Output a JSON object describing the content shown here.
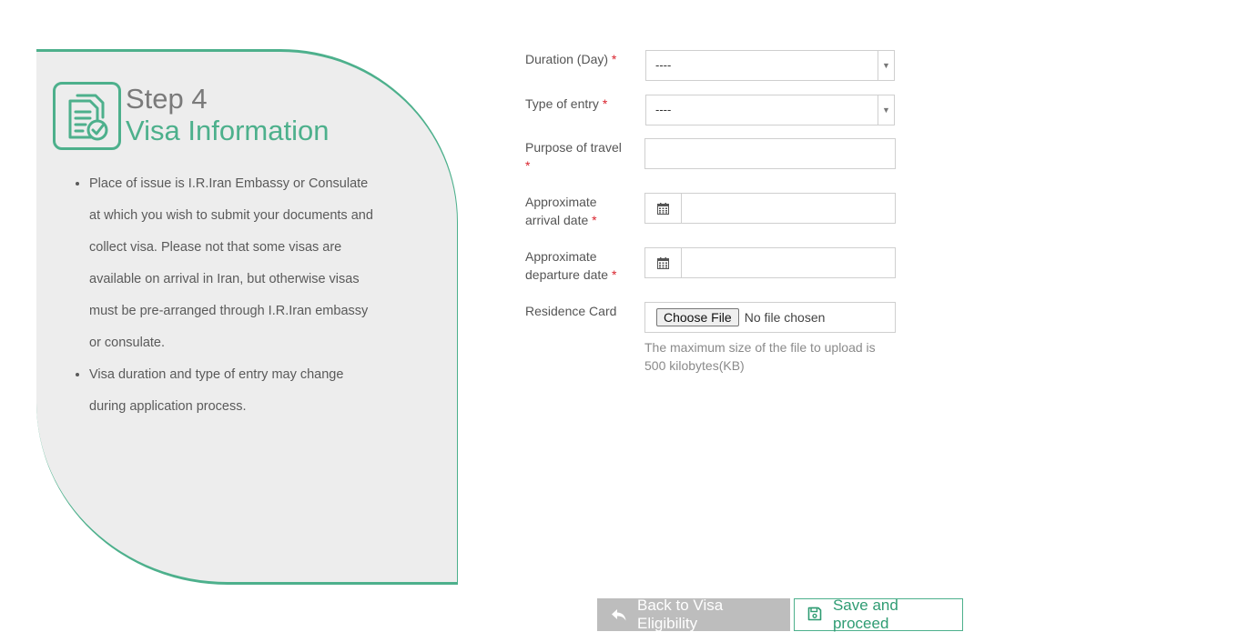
{
  "step": {
    "number_label": "Step 4",
    "title": "Visa Information",
    "icon": "document-check-icon",
    "bullets": [
      "Place of issue is I.R.Iran Embassy or Consulate at which you wish to submit your documents and collect visa. Please not that some visas are available on arrival in Iran, but otherwise visas must be pre-arranged through I.R.Iran embassy or consulate.",
      "Visa duration and type of entry may change during application process."
    ]
  },
  "form": {
    "required_marker": "*",
    "duration": {
      "label": "Duration (Day)",
      "value": "----"
    },
    "entry_type": {
      "label": "Type of entry",
      "value": "----"
    },
    "purpose": {
      "label": "Purpose of travel",
      "value": ""
    },
    "arrival": {
      "label": "Approximate arrival date",
      "value": "",
      "icon": "calendar-icon"
    },
    "departure": {
      "label": "Approximate departure date",
      "value": "",
      "icon": "calendar-icon"
    },
    "residence_card": {
      "label": "Residence Card",
      "button_label": "Choose File",
      "status": "No file chosen",
      "hint": "The maximum size of the file to upload is 500 kilobytes(KB)"
    }
  },
  "buttons": {
    "back": {
      "label": "Back to Visa Eligibility",
      "icon": "reply-icon"
    },
    "save": {
      "label": "Save and proceed",
      "icon": "floppy-disk-icon"
    }
  },
  "colors": {
    "accent": "#4db08c",
    "panel_bg": "#ededed",
    "required": "#d9232d",
    "back_button_bg": "#bdbdbd"
  }
}
